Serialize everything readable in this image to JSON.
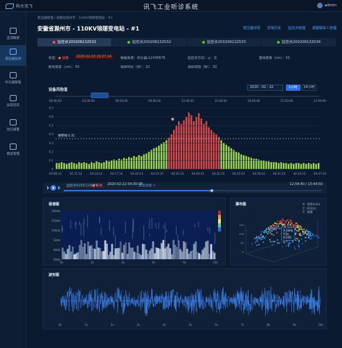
{
  "app": {
    "logo": "科大讯飞",
    "title": "讯飞工业听诊系统",
    "user": "admin"
  },
  "sidebar": {
    "items": [
      {
        "label": "监测概要",
        "active": false
      },
      {
        "label": "变压器监测",
        "active": true
      },
      {
        "label": "听诊器管理",
        "active": false
      },
      {
        "label": "异常历史",
        "active": false
      },
      {
        "label": "短信报警",
        "active": false
      },
      {
        "label": "模型管理",
        "active": false
      }
    ]
  },
  "breadcrumb": "变压器管理 / 安徽省滁州市 - 110KV琅琊变电站 - #1",
  "page": {
    "title": "安徽省滁州市 - 110KV琅琊变电站 - #1",
    "actions": [
      "变压器详情",
      "异常历史",
      "监控点管理",
      "报警联系人管理"
    ]
  },
  "tabs": [
    {
      "label": "监控点200206132531",
      "active": true,
      "color": "#ff4d4f"
    },
    {
      "label": "监控点200206132532",
      "active": false,
      "color": "#52c41a"
    },
    {
      "label": "监控点200206132533",
      "active": false,
      "color": "#52c41a"
    },
    {
      "label": "监控点200206132534",
      "active": false,
      "color": "#52c41a"
    }
  ],
  "info": {
    "status_label": "状态：",
    "status_value": "● 报警",
    "status_time": "2020-02-03  20:07:24",
    "model_label": "数据来源：听诊器-12345678",
    "direction_label": "监控点方向：◎：东",
    "vertical_label": "直线距离（cm）：50",
    "height_label": "距地高度（cm）：50",
    "duration_label": "采样时长（秒）：10",
    "interval_label": "采样间隔（秒）：30"
  },
  "chart": {
    "title": "设备风险值",
    "date": "2020 - 02 - 22",
    "range_1h": "1小时",
    "range_24h": "24小时",
    "threshold_label": "报警线  0.35",
    "top_ticks": [
      "00:00:00",
      "03:00:00",
      "06:00:00",
      "09:00:00",
      "12:00:00",
      "15:00:00",
      "18:00:00",
      "21:00:00",
      "24:00:00"
    ],
    "bottom_ticks": [
      "04:08:14",
      "04:11:14",
      "04:14:14",
      "04:17:14",
      "04:20:14",
      "04:23:14",
      "04:26:14",
      "04:29:14",
      "04:32:14",
      "04:35:14",
      "04:38:14",
      "04:41:14",
      "04:44:14",
      "04:47:14"
    ],
    "y_ticks": [
      "0.7",
      "0.6",
      "0.5",
      "0.4",
      "0.3",
      "0.2",
      "0.1",
      "0"
    ],
    "threshold": 0.35,
    "values": [
      0.07,
      0.07,
      0.08,
      0.07,
      0.06,
      0.07,
      0.08,
      0.07,
      0.06,
      0.08,
      0.07,
      0.08,
      0.07,
      0.06,
      0.08,
      0.07,
      0.09,
      0.08,
      0.07,
      0.08,
      0.1,
      0.09,
      0.1,
      0.11,
      0.1,
      0.12,
      0.11,
      0.13,
      0.12,
      0.14,
      0.13,
      0.15,
      0.14,
      0.16,
      0.15,
      0.17,
      0.18,
      0.2,
      0.22,
      0.24,
      0.25,
      0.27,
      0.29,
      0.31,
      0.33,
      0.36,
      0.4,
      0.45,
      0.5,
      0.55,
      0.52,
      0.56,
      0.6,
      0.65,
      0.62,
      0.55,
      0.6,
      0.64,
      0.58,
      0.52,
      0.55,
      0.48,
      0.45,
      0.42,
      0.4,
      0.37,
      0.33,
      0.3,
      0.28,
      0.26,
      0.24,
      0.22,
      0.2,
      0.19,
      0.17,
      0.16,
      0.15,
      0.14,
      0.13,
      0.12,
      0.12,
      0.11,
      0.1,
      0.1,
      0.09,
      0.09,
      0.08,
      0.08,
      0.08,
      0.07,
      0.08,
      0.07,
      0.07,
      0.06,
      0.07,
      0.06,
      0.07,
      0.07,
      0.06,
      0.07,
      0.06,
      0.07,
      0.06,
      0.07,
      0.06,
      0.07
    ],
    "colors": {
      "normal": "#a0d94b",
      "alarm": "#e04848",
      "bg": "#0b1a2e",
      "grid": "#1a2e49"
    }
  },
  "player": {
    "monitor": "监控点0205113045",
    "alarm": "● 报警",
    "time": "2020-02-22  04:30:08",
    "detail": "异常详情  >",
    "progress": "12:04:40 / 13:44:50"
  },
  "spectrogram": {
    "title": "语谱图",
    "y_ticks": [
      "20kHz",
      "15kHz",
      "10kHz",
      "5kHz",
      "4kHz",
      "0kHz"
    ],
    "x_ticks": [
      "0s",
      "1s",
      "2s",
      "3s",
      "4s",
      "5s",
      "6s",
      "7s",
      "8s",
      "9s",
      "10s"
    ]
  },
  "scatter3d": {
    "title": "瀑布图",
    "legend": [
      "X：频率(kHz)",
      "Y：时间(s)",
      "Z：能量"
    ],
    "tooltip": [
      "X:1kHz",
      "Y:2s",
      "Z:250"
    ]
  },
  "waveform": {
    "title": "波形图",
    "x_ticks": [
      "0s",
      "1s",
      "2s",
      "3s",
      "4s",
      "5s",
      "6s",
      "7s",
      "8s",
      "9s",
      "10s"
    ]
  }
}
